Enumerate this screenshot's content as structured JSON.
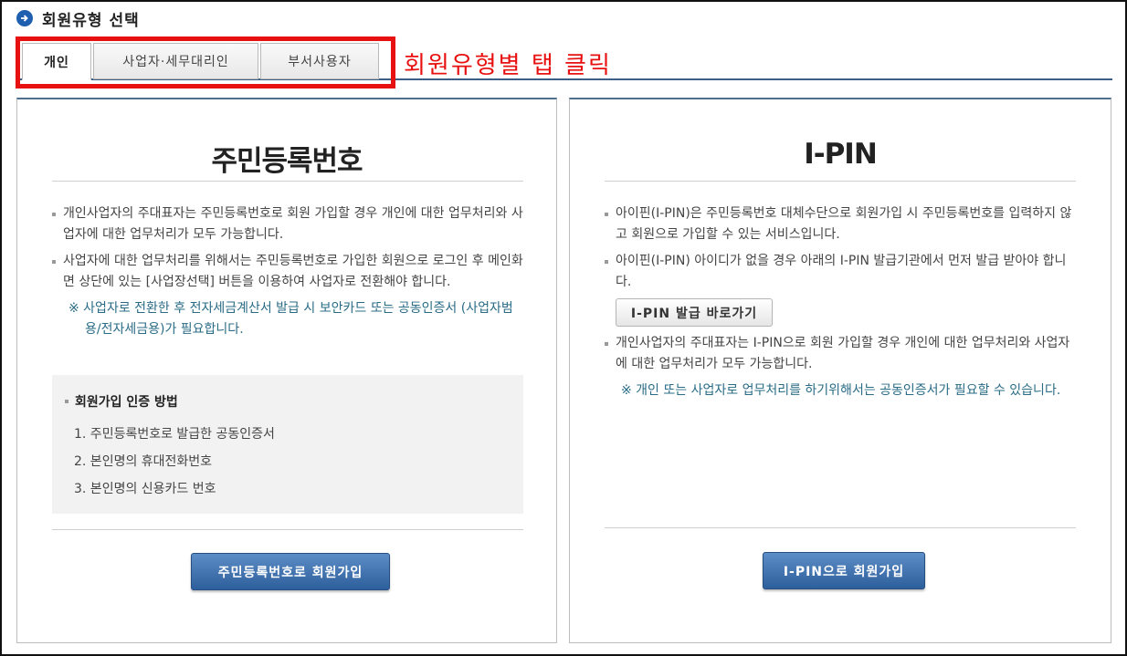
{
  "header": {
    "title": "회원유형 선택",
    "icon": "arrow-right-circle-icon"
  },
  "tabs": [
    {
      "label": "개인",
      "active": true
    },
    {
      "label": "사업자·세무대리인",
      "active": false
    },
    {
      "label": "부서사용자",
      "active": false
    }
  ],
  "annotation": {
    "text": "회원유형별 탭 클릭",
    "color": "#e81111"
  },
  "left_panel": {
    "title": "주민등록번호",
    "bullets": [
      "개인사업자의 주대표자는 주민등록번호로 회원 가입할 경우 개인에 대한 업무처리와 사업자에 대한 업무처리가 모두 가능합니다.",
      "사업자에 대한 업무처리를 위해서는 주민등록번호로 가입한 회원으로 로그인 후 메인화면 상단에 있는 [사업장선택] 버튼을 이용하여 사업자로 전환해야 합니다."
    ],
    "note": "※ 사업자로 전환한 후 전자세금계산서 발급 시 보안카드 또는 공동인증서 (사업자범용/전자세금용)가 필요합니다.",
    "methods": {
      "title": "회원가입 인증 방법",
      "items": [
        "1. 주민등록번호로 발급한 공동인증서",
        "2. 본인명의 휴대전화번호",
        "3. 본인명의 신용카드 번호"
      ]
    },
    "button_label": "주민등록번호로 회원가입"
  },
  "right_panel": {
    "title": "I-PIN",
    "bullets": [
      "아이핀(I-PIN)은 주민등록번호 대체수단으로 회원가입 시 주민등록번호를 입력하지 않고 회원으로 가입할 수 있는 서비스입니다.",
      "아이핀(I-PIN) 아이디가 없을 경우 아래의 I-PIN 발급기관에서 먼저 발급 받아야 합니다.",
      "개인사업자의 주대표자는 I-PIN으로 회원 가입할 경우 개인에 대한 업무처리와 사업자에 대한 업무처리가 모두 가능합니다."
    ],
    "issue_button_label": "I-PIN 발급 바로가기",
    "note": "※ 개인 또는 사업자로 업무처리를 하기위해서는 공동인증서가 필요할 수 있습니다.",
    "button_label": "I-PIN으로 회원가입"
  },
  "colors": {
    "accent": "#2d5f9c",
    "note": "#2a6c86",
    "highlight": "#e81111"
  }
}
